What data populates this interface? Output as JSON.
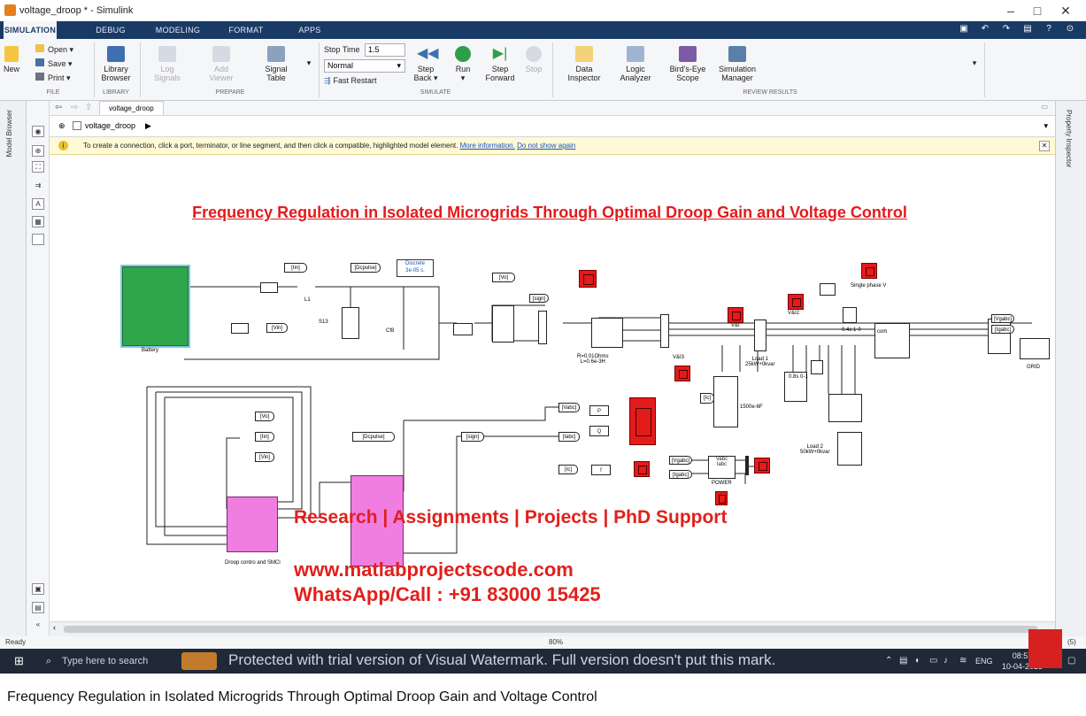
{
  "window": {
    "title": "voltage_droop * - Simulink",
    "controls": [
      "–",
      "□",
      "✕"
    ]
  },
  "tabs": [
    "SIMULATION",
    "DEBUG",
    "MODELING",
    "FORMAT",
    "APPS"
  ],
  "ribbon": {
    "file": {
      "open": "Open",
      "save": "Save",
      "print": "Print",
      "new_line1": "New",
      "label": "FILE"
    },
    "library": {
      "button_line1": "Library",
      "button_line2": "Browser",
      "label": "LIBRARY"
    },
    "prepare": {
      "log_line1": "Log",
      "log_line2": "Signals",
      "add_line1": "Add",
      "add_line2": "Viewer",
      "table_line1": "Signal",
      "table_line2": "Table",
      "label": "PREPARE"
    },
    "simulate": {
      "stop_time_label": "Stop Time",
      "stop_time_value": "1.5",
      "mode_value": "Normal",
      "fast_restart": "Fast Restart",
      "step_back_line1": "Step",
      "step_back_line2": "Back",
      "run": "Run",
      "step_fwd_line1": "Step",
      "step_fwd_line2": "Forward",
      "stop": "Stop",
      "label": "SIMULATE"
    },
    "review": {
      "data_line1": "Data",
      "data_line2": "Inspector",
      "logic_line1": "Logic",
      "logic_line2": "Analyzer",
      "birds_line1": "Bird's-Eye",
      "birds_line2": "Scope",
      "simmgr_line1": "Simulation",
      "simmgr_line2": "Manager",
      "label": "REVIEW RESULTS"
    }
  },
  "left_panel_title": "Model Browser",
  "right_panel_title": "Property Inspector",
  "nav_tab": "voltage_droop",
  "breadcrumb": "voltage_droop",
  "infobar": {
    "message": "To create a connection, click a port, terminator, or line segment, and then click a compatible, highlighted model element.",
    "link1": "More information.",
    "link2": "Do not show again"
  },
  "model": {
    "title": "Frequency Regulation in Isolated Microgrids Through Optimal Droop Gain and Voltage Control",
    "powergui_line1": "Discrete",
    "powergui_line2": "3e-05 s.",
    "labels": {
      "battery": "Battery",
      "l1": "L1",
      "s13": "S13",
      "cf8": "Cf8",
      "rl_line1": "R=0.01Ohms",
      "rl_line2": "L=0.6e-3H",
      "vi": "V&I",
      "vi2": "V&I2",
      "vi3": "V&I3",
      "single_phase": "Single phase V",
      "load1_line1": "Load 1",
      "load1_line2": "25kW+0kvar",
      "load2_line1": "Load 2",
      "load2_line2": "50kW+0kvar",
      "cap": "1500e-6F",
      "step1": "0.4s 1-0",
      "step2": "0.8s 0-1",
      "com": "com",
      "grid": "GRID",
      "droop": "Droop contro and SMCl",
      "power": "POWER",
      "vabc_in": "Vabc",
      "iabc_in": "Iabc",
      "p": "P",
      "q": "Q",
      "f": "f"
    },
    "tags": {
      "iin": "[Iin]",
      "dcpulse": "[Dcpulse]",
      "vo": "[Vo]",
      "vin": "[Vin]",
      "sign": "[sign]",
      "vabc": "[Vabc]",
      "iabc": "[Iabc]",
      "ic": "[Ic]",
      "vgabc": "[Vgabc]",
      "igabc": "[Igabc]"
    }
  },
  "watermark": {
    "line1": "Research | Assignments | Projects | PhD Support",
    "line2": "www.matlabprojectscode.com",
    "line3": "WhatsApp/Call : +91 83000 15425"
  },
  "status": {
    "left": "Ready",
    "zoom": "80%",
    "right": "(5)"
  },
  "taskbar": {
    "search_placeholder": "Type here to search",
    "overlay_text": "Protected with trial version of Visual Watermark. Full version doesn't put this mark.",
    "lang": "ENG",
    "time": "08:57",
    "date": "10-04-2023"
  },
  "caption": "Frequency Regulation in Isolated Microgrids Through Optimal Droop Gain and Voltage Control",
  "colors": {
    "tab_strip": "#1a3a66",
    "accent_red": "#e31b1b",
    "battery_green": "#2fa64a",
    "subsystem_pink": "#f07de0"
  }
}
